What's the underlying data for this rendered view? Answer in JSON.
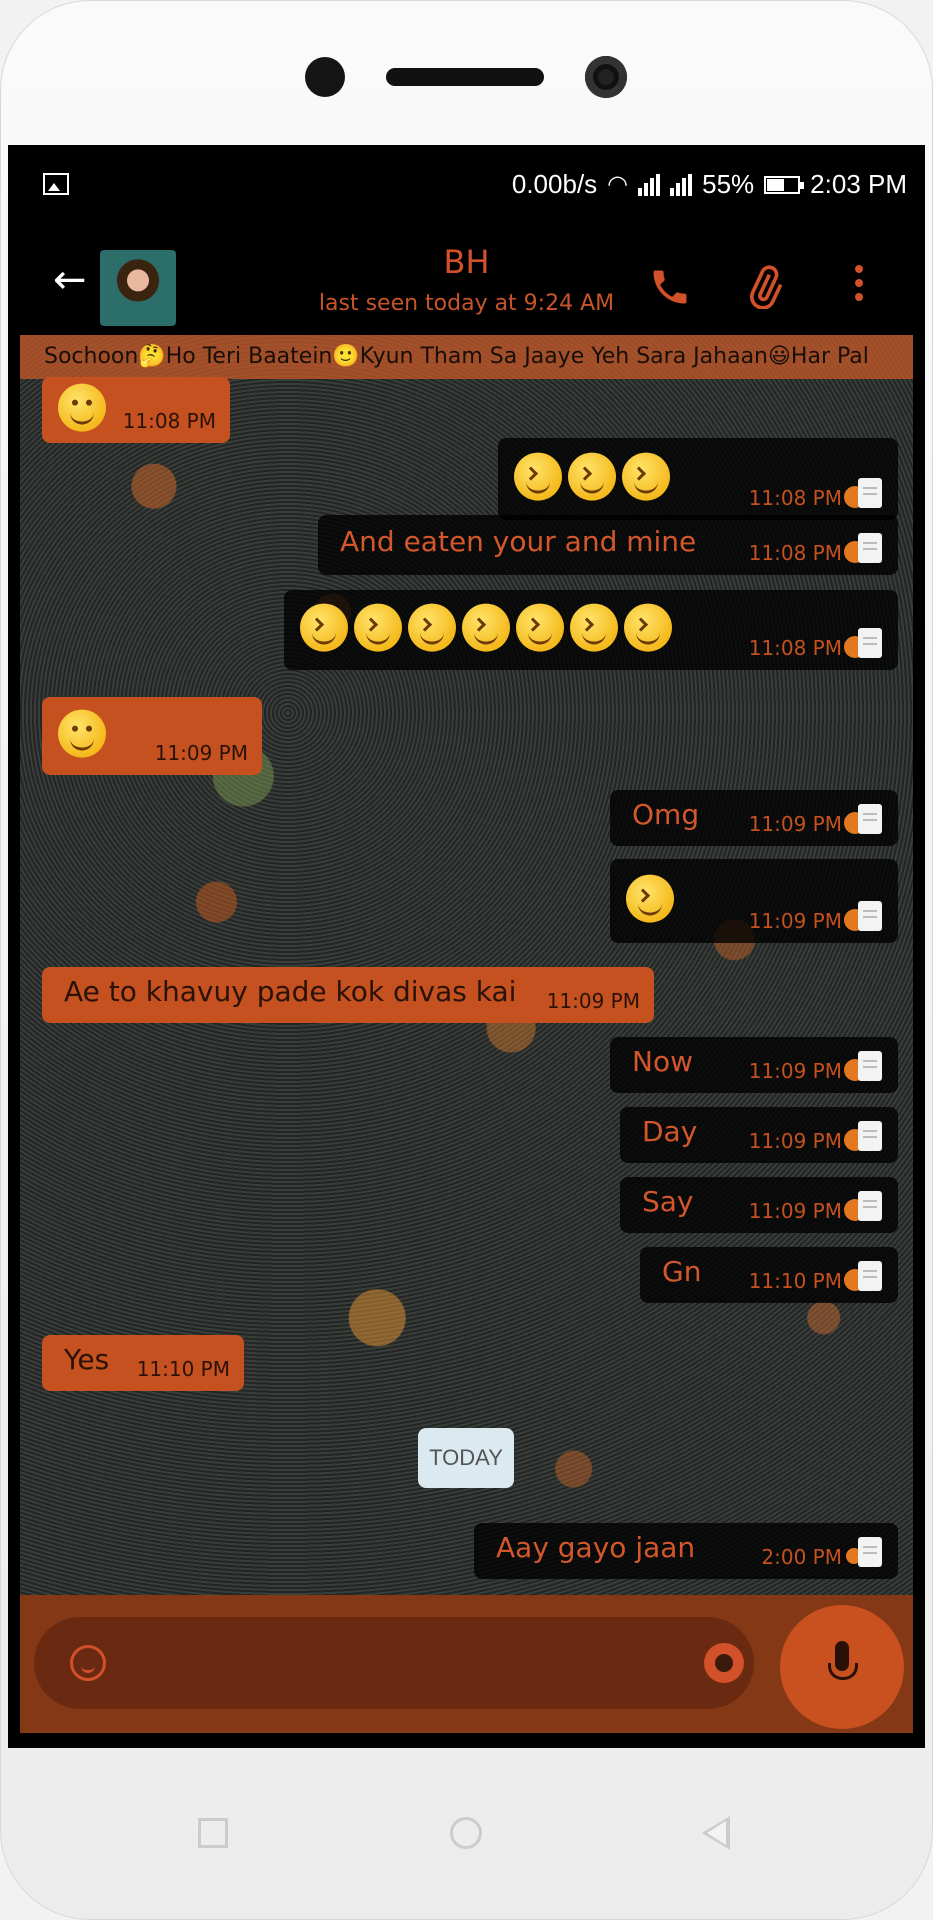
{
  "status_bar": {
    "speed": "0.00b/s",
    "battery": "55%",
    "time": "2:03 PM"
  },
  "header": {
    "contact_name": "BH",
    "last_seen": "last seen today at 9:24 AM"
  },
  "ticker": "Sochoon🤔Ho Teri Baatein🙂Kyun Tham Sa Jaaye Yeh Sara Jahaan😃Har Pal",
  "messages": [
    {
      "side": "in",
      "emojis": [
        "wink"
      ],
      "time": "11:08 PM"
    },
    {
      "side": "out",
      "emojis": [
        "laugh",
        "laugh",
        "laugh"
      ],
      "time": "11:08 PM",
      "status": "read"
    },
    {
      "side": "out",
      "text": "And eaten your and mine",
      "time": "11:08 PM",
      "status": "read"
    },
    {
      "side": "out",
      "emojis": [
        "laugh",
        "laugh",
        "laugh",
        "laugh",
        "laugh",
        "laugh",
        "laugh"
      ],
      "time": "11:08 PM",
      "status": "read"
    },
    {
      "side": "in",
      "emojis": [
        "wink"
      ],
      "time": "11:09 PM"
    },
    {
      "side": "out",
      "text": "Omg",
      "time": "11:09 PM",
      "status": "read"
    },
    {
      "side": "out",
      "emojis": [
        "laugh"
      ],
      "time": "11:09 PM",
      "status": "read"
    },
    {
      "side": "in",
      "text": "Ae to khavuy pade kok divas kai",
      "time": "11:09 PM"
    },
    {
      "side": "out",
      "text": "Now",
      "time": "11:09 PM",
      "status": "read"
    },
    {
      "side": "out",
      "text": "Day",
      "time": "11:09 PM",
      "status": "read"
    },
    {
      "side": "out",
      "text": "Say",
      "time": "11:09 PM",
      "status": "read"
    },
    {
      "side": "out",
      "text": "Gn",
      "time": "11:10 PM",
      "status": "read"
    },
    {
      "side": "in",
      "text": "Yes",
      "time": "11:10 PM"
    },
    {
      "side": "out",
      "text": "Aay gayo jaan",
      "time": "2:00 PM",
      "status": "pending"
    }
  ],
  "date_divider": "TODAY",
  "colors": {
    "accent": "#d2502a",
    "bubble_in": "#c4511f",
    "bubble_out": "#000000",
    "read_tick": "#e2781f"
  },
  "icons": [
    "back-arrow-icon",
    "phone-icon",
    "paperclip-icon",
    "more-vert-icon",
    "emoji-icon",
    "camera-icon",
    "mic-icon"
  ]
}
